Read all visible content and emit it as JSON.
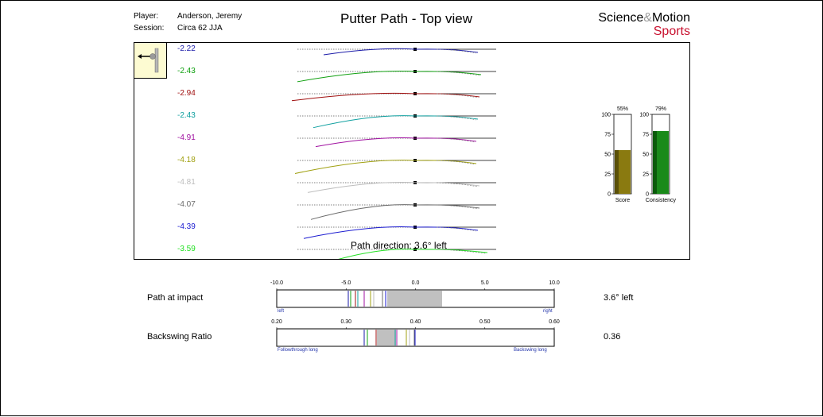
{
  "header": {
    "player_label": "Player:",
    "player_value": "Anderson, Jeremy",
    "session_label": "Session:",
    "session_value": "Circa 62 JJA",
    "title": "Putter Path - Top view",
    "logo_line1_a": "Science",
    "logo_amp": "&",
    "logo_line1_b": "Motion",
    "logo_line2": "Sports"
  },
  "putts": [
    {
      "value": "-2.22",
      "color": "#1a1aa8"
    },
    {
      "value": "-2.43",
      "color": "#10a010"
    },
    {
      "value": "-2.94",
      "color": "#a01010"
    },
    {
      "value": "-2.43",
      "color": "#10a0a0"
    },
    {
      "value": "-4.91",
      "color": "#a010a0"
    },
    {
      "value": "-4.18",
      "color": "#a0a010"
    },
    {
      "value": "-4.81",
      "color": "#bdbdbd"
    },
    {
      "value": "-4.07",
      "color": "#6a6a6a"
    },
    {
      "value": "-4.39",
      "color": "#1a1ad0"
    },
    {
      "value": "-3.59",
      "color": "#22e022"
    }
  ],
  "path_direction": "Path direction: 3.6° left",
  "score_bars": [
    {
      "name": "Score",
      "value": 55,
      "pct_label": "55%",
      "color": "#8a7a10",
      "color_light": "#5a5008"
    },
    {
      "name": "Consistency",
      "value": 79,
      "pct_label": "79%",
      "color": "#1a8a1a",
      "color_light": "#0a5a0a"
    }
  ],
  "bar_ticks": [
    "100",
    "75",
    "50",
    "25",
    "0"
  ],
  "path_at_impact": {
    "label": "Path at impact",
    "value_text": "3.6° left",
    "ticks": [
      "-10.0",
      "-5.0",
      "0.0",
      "5.0",
      "10.0"
    ],
    "left_label": "left",
    "right_label": "right"
  },
  "backswing_ratio": {
    "label": "Backswing Ratio",
    "value_text": "0.36",
    "ticks": [
      "0.20",
      "0.30",
      "0.40",
      "0.50",
      "0.60"
    ],
    "left_label": "Followthrough long",
    "right_label": "Backswing long"
  }
}
